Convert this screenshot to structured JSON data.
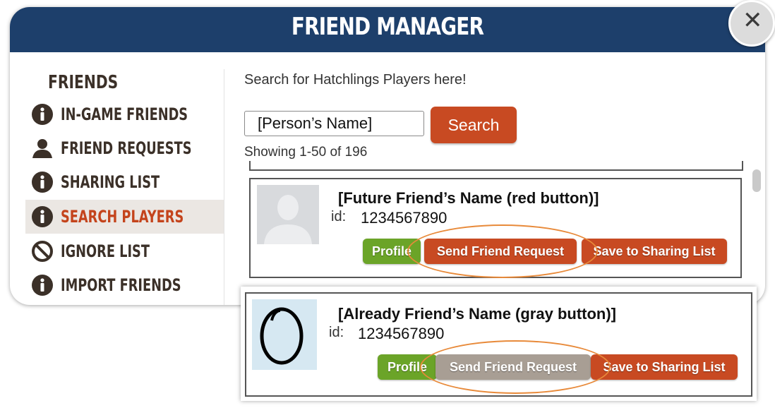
{
  "dialog": {
    "title": "FRIEND MANAGER",
    "close_icon": "close-icon"
  },
  "sidebar": {
    "heading": "FRIENDS",
    "items": [
      {
        "label": "IN-GAME FRIENDS",
        "icon": "info-icon",
        "active": false
      },
      {
        "label": "FRIEND REQUESTS",
        "icon": "person-icon",
        "active": false
      },
      {
        "label": "SHARING LIST",
        "icon": "info-icon",
        "active": false
      },
      {
        "label": "SEARCH PLAYERS",
        "icon": "info-icon",
        "active": true
      },
      {
        "label": "IGNORE LIST",
        "icon": "no-entry-icon",
        "active": false
      },
      {
        "label": "IMPORT FRIENDS",
        "icon": "info-icon",
        "active": false
      }
    ]
  },
  "search": {
    "hint": "Search for Hatchlings Players here!",
    "input_value": "[Person’s Name]",
    "button_label": "Search",
    "showing": "Showing 1-50 of 196"
  },
  "results": [
    {
      "name": "[Future Friend’s Name (red button)]",
      "id_label": "id:",
      "id": "1234567890",
      "avatar": "silhouette-avatar",
      "profile_label": "Profile",
      "request_label": "Send Friend Request",
      "request_state": "red",
      "share_label": "Save to Sharing List"
    },
    {
      "name": "[Already Friend’s Name (gray button)]",
      "id_label": "id:",
      "id": "1234567890",
      "avatar": "egg-avatar",
      "profile_label": "Profile",
      "request_label": "Send Friend Request",
      "request_state": "gray",
      "share_label": "Save to Sharing List"
    }
  ],
  "colors": {
    "header": "#1d3f6b",
    "accent_red": "#c84a22",
    "profile_green": "#6ba428",
    "disabled_gray": "#a89e94",
    "highlight_orange": "#e88a3a",
    "active_nav_text": "#c4441c"
  }
}
